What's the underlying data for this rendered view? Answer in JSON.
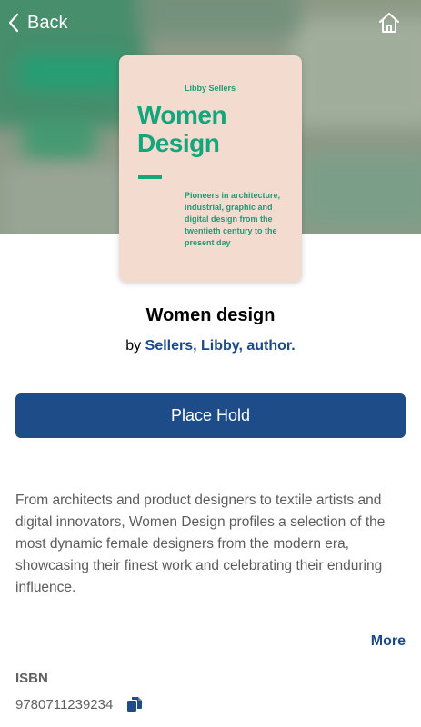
{
  "nav": {
    "back_label": "Back",
    "home_icon": "home-icon",
    "back_icon": "chevron-left-icon"
  },
  "cover": {
    "author": "Libby Sellers",
    "title_line1": "Women",
    "title_line2": "Design",
    "subtitle": "Pioneers in architecture, industrial, graphic and digital design from the twentieth century to the present day",
    "bg_color": "#f4dbcf",
    "accent_color": "#13a57c"
  },
  "book": {
    "title": "Women design",
    "by_prefix": "by",
    "author": "Sellers, Libby, author."
  },
  "actions": {
    "place_hold_label": "Place Hold",
    "more_label": "More"
  },
  "description": "From architects and product designers to textile artists and digital innovators, Women Design profiles a selection of the most dynamic female designers from the modern era, showcasing their finest work and celebrating their enduring influence.",
  "details": {
    "isbn_label": "ISBN",
    "isbn_value": "9780711239234",
    "copy_icon": "copy-icon"
  },
  "colors": {
    "primary": "#1d4c89",
    "link": "#1c4a8a"
  }
}
